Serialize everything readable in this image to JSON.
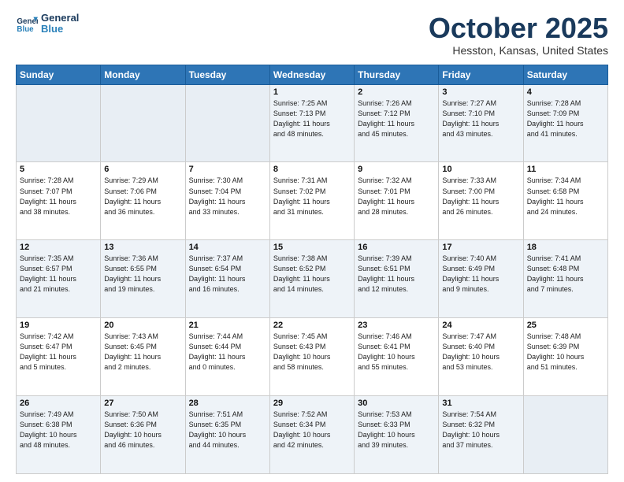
{
  "header": {
    "logo_general": "General",
    "logo_blue": "Blue",
    "month": "October 2025",
    "location": "Hesston, Kansas, United States"
  },
  "days_of_week": [
    "Sunday",
    "Monday",
    "Tuesday",
    "Wednesday",
    "Thursday",
    "Friday",
    "Saturday"
  ],
  "weeks": [
    [
      {
        "day": "",
        "info": ""
      },
      {
        "day": "",
        "info": ""
      },
      {
        "day": "",
        "info": ""
      },
      {
        "day": "1",
        "info": "Sunrise: 7:25 AM\nSunset: 7:13 PM\nDaylight: 11 hours\nand 48 minutes."
      },
      {
        "day": "2",
        "info": "Sunrise: 7:26 AM\nSunset: 7:12 PM\nDaylight: 11 hours\nand 45 minutes."
      },
      {
        "day": "3",
        "info": "Sunrise: 7:27 AM\nSunset: 7:10 PM\nDaylight: 11 hours\nand 43 minutes."
      },
      {
        "day": "4",
        "info": "Sunrise: 7:28 AM\nSunset: 7:09 PM\nDaylight: 11 hours\nand 41 minutes."
      }
    ],
    [
      {
        "day": "5",
        "info": "Sunrise: 7:28 AM\nSunset: 7:07 PM\nDaylight: 11 hours\nand 38 minutes."
      },
      {
        "day": "6",
        "info": "Sunrise: 7:29 AM\nSunset: 7:06 PM\nDaylight: 11 hours\nand 36 minutes."
      },
      {
        "day": "7",
        "info": "Sunrise: 7:30 AM\nSunset: 7:04 PM\nDaylight: 11 hours\nand 33 minutes."
      },
      {
        "day": "8",
        "info": "Sunrise: 7:31 AM\nSunset: 7:02 PM\nDaylight: 11 hours\nand 31 minutes."
      },
      {
        "day": "9",
        "info": "Sunrise: 7:32 AM\nSunset: 7:01 PM\nDaylight: 11 hours\nand 28 minutes."
      },
      {
        "day": "10",
        "info": "Sunrise: 7:33 AM\nSunset: 7:00 PM\nDaylight: 11 hours\nand 26 minutes."
      },
      {
        "day": "11",
        "info": "Sunrise: 7:34 AM\nSunset: 6:58 PM\nDaylight: 11 hours\nand 24 minutes."
      }
    ],
    [
      {
        "day": "12",
        "info": "Sunrise: 7:35 AM\nSunset: 6:57 PM\nDaylight: 11 hours\nand 21 minutes."
      },
      {
        "day": "13",
        "info": "Sunrise: 7:36 AM\nSunset: 6:55 PM\nDaylight: 11 hours\nand 19 minutes."
      },
      {
        "day": "14",
        "info": "Sunrise: 7:37 AM\nSunset: 6:54 PM\nDaylight: 11 hours\nand 16 minutes."
      },
      {
        "day": "15",
        "info": "Sunrise: 7:38 AM\nSunset: 6:52 PM\nDaylight: 11 hours\nand 14 minutes."
      },
      {
        "day": "16",
        "info": "Sunrise: 7:39 AM\nSunset: 6:51 PM\nDaylight: 11 hours\nand 12 minutes."
      },
      {
        "day": "17",
        "info": "Sunrise: 7:40 AM\nSunset: 6:49 PM\nDaylight: 11 hours\nand 9 minutes."
      },
      {
        "day": "18",
        "info": "Sunrise: 7:41 AM\nSunset: 6:48 PM\nDaylight: 11 hours\nand 7 minutes."
      }
    ],
    [
      {
        "day": "19",
        "info": "Sunrise: 7:42 AM\nSunset: 6:47 PM\nDaylight: 11 hours\nand 5 minutes."
      },
      {
        "day": "20",
        "info": "Sunrise: 7:43 AM\nSunset: 6:45 PM\nDaylight: 11 hours\nand 2 minutes."
      },
      {
        "day": "21",
        "info": "Sunrise: 7:44 AM\nSunset: 6:44 PM\nDaylight: 11 hours\nand 0 minutes."
      },
      {
        "day": "22",
        "info": "Sunrise: 7:45 AM\nSunset: 6:43 PM\nDaylight: 10 hours\nand 58 minutes."
      },
      {
        "day": "23",
        "info": "Sunrise: 7:46 AM\nSunset: 6:41 PM\nDaylight: 10 hours\nand 55 minutes."
      },
      {
        "day": "24",
        "info": "Sunrise: 7:47 AM\nSunset: 6:40 PM\nDaylight: 10 hours\nand 53 minutes."
      },
      {
        "day": "25",
        "info": "Sunrise: 7:48 AM\nSunset: 6:39 PM\nDaylight: 10 hours\nand 51 minutes."
      }
    ],
    [
      {
        "day": "26",
        "info": "Sunrise: 7:49 AM\nSunset: 6:38 PM\nDaylight: 10 hours\nand 48 minutes."
      },
      {
        "day": "27",
        "info": "Sunrise: 7:50 AM\nSunset: 6:36 PM\nDaylight: 10 hours\nand 46 minutes."
      },
      {
        "day": "28",
        "info": "Sunrise: 7:51 AM\nSunset: 6:35 PM\nDaylight: 10 hours\nand 44 minutes."
      },
      {
        "day": "29",
        "info": "Sunrise: 7:52 AM\nSunset: 6:34 PM\nDaylight: 10 hours\nand 42 minutes."
      },
      {
        "day": "30",
        "info": "Sunrise: 7:53 AM\nSunset: 6:33 PM\nDaylight: 10 hours\nand 39 minutes."
      },
      {
        "day": "31",
        "info": "Sunrise: 7:54 AM\nSunset: 6:32 PM\nDaylight: 10 hours\nand 37 minutes."
      },
      {
        "day": "",
        "info": ""
      }
    ]
  ]
}
